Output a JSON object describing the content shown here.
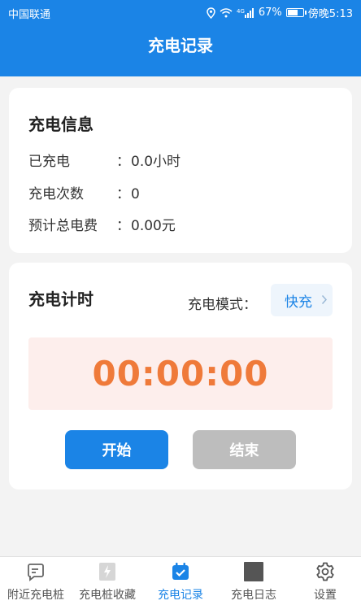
{
  "status_bar": {
    "carrier": "中国联通",
    "battery": "67%",
    "battery_level": 0.67,
    "time": "傍晚5:13",
    "signal_label": "4G"
  },
  "header": {
    "title": "充电记录"
  },
  "charge_info": {
    "title": "充电信息",
    "rows": [
      {
        "label": "已充电",
        "colon": "：",
        "value": "0.0小时"
      },
      {
        "label": "充电次数",
        "colon": "：",
        "value": "0"
      },
      {
        "label": "预计总电费",
        "colon": "：",
        "value": "0.00元"
      }
    ]
  },
  "charge_timer": {
    "title": "充电计时",
    "mode_label": "充电模式：",
    "mode_value": "快充",
    "time": "00:00:00",
    "start_label": "开始",
    "end_label": "结束"
  },
  "tabbar": {
    "items": [
      {
        "label": "附近充电桩",
        "icon": "chat-note-icon"
      },
      {
        "label": "充电桩收藏",
        "icon": "bolt-card-icon"
      },
      {
        "label": "充电记录",
        "icon": "calendar-check-icon",
        "active": true
      },
      {
        "label": "充电日志",
        "icon": "log-square-icon"
      },
      {
        "label": "设置",
        "icon": "gear-icon"
      }
    ]
  },
  "colors": {
    "primary": "#1b84e6",
    "timer_text": "#ef7a3a",
    "timer_bg": "#fdeeec",
    "disabled": "#bdbdbd"
  }
}
